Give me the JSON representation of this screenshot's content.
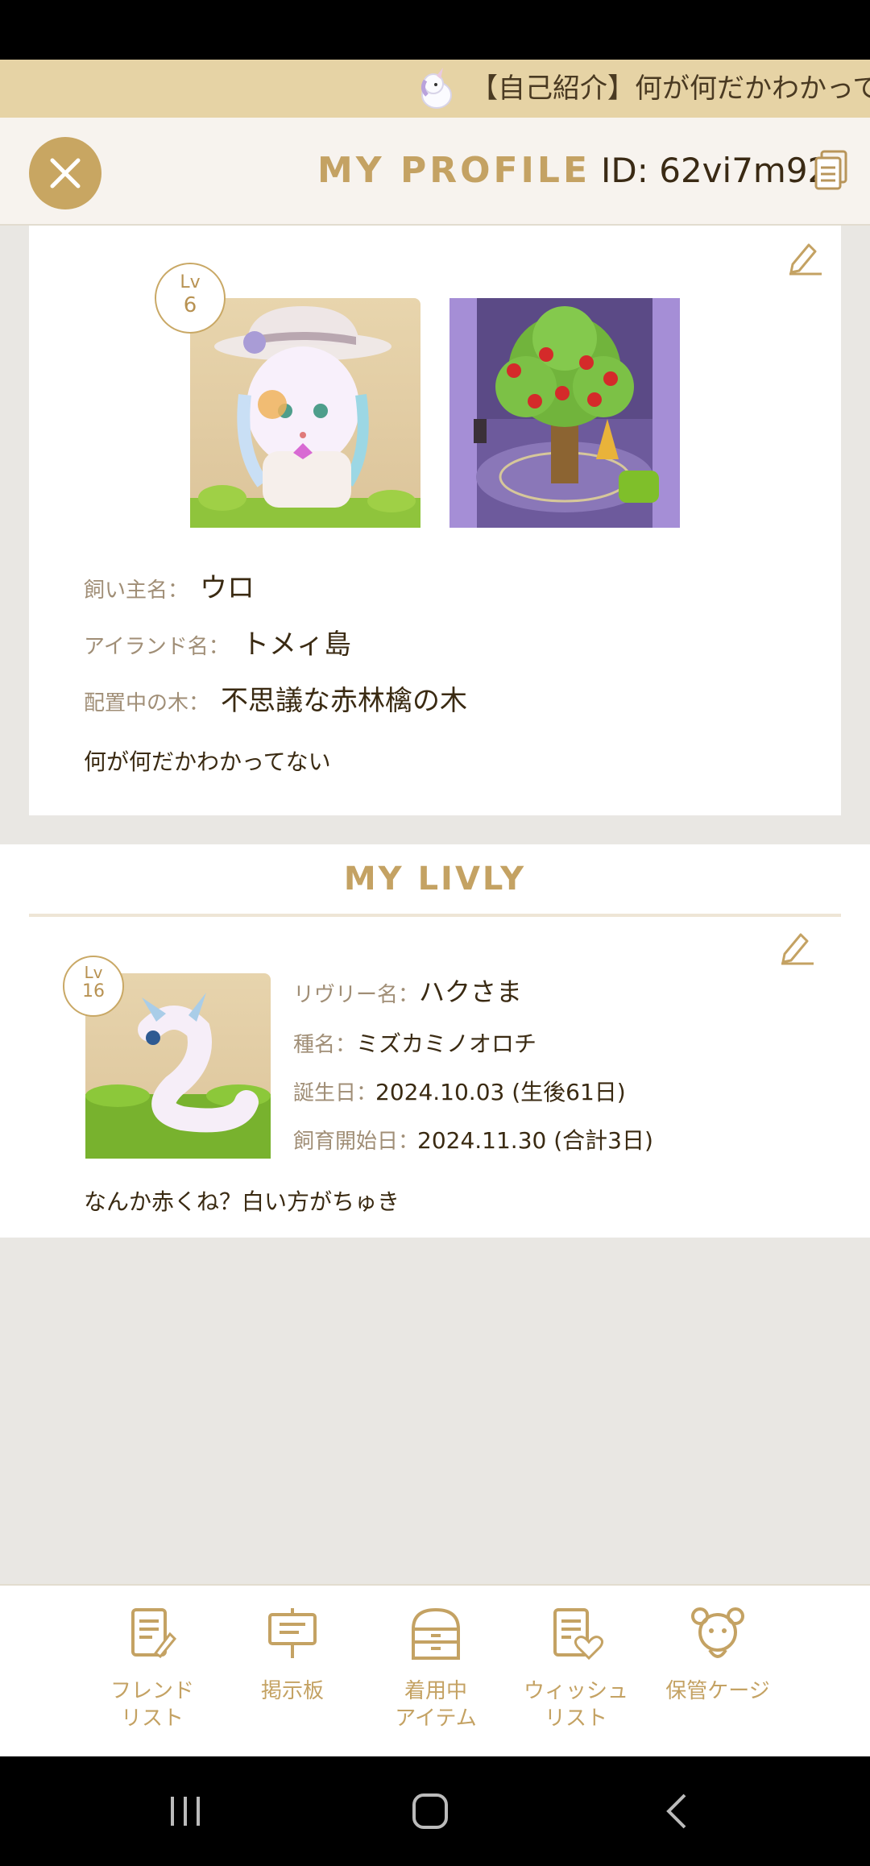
{
  "ticker": {
    "icon": "unicorn-icon",
    "text": "【自己紹介】何が何だかわかって"
  },
  "header": {
    "close_icon": "close-icon",
    "title": "MY PROFILE",
    "id_text": "ID: 62vi7m92",
    "copy_icon": "copy-icon"
  },
  "profile": {
    "level_label": "Lv",
    "level": "6",
    "avatar_image": "owner-avatar-image",
    "island_image": "island-tree-image",
    "fields": [
      {
        "label": "飼い主名：",
        "value": "ウロ"
      },
      {
        "label": "アイランド名：",
        "value": "トメィ島"
      },
      {
        "label": "配置中の木：",
        "value": "不思議な赤林檎の木"
      }
    ],
    "bio": "何が何だかわかってない"
  },
  "livly": {
    "section_title": "MY LIVLY",
    "level_label": "Lv",
    "level": "16",
    "image": "livly-image",
    "fields": [
      {
        "label": "リヴリー名：",
        "value": "ハクさま"
      },
      {
        "label": "種名：",
        "value": "ミズカミノオロチ"
      },
      {
        "label": "誕生日：",
        "value": "2024.10.03 (生後61日)"
      },
      {
        "label": "飼育開始日：",
        "value": "2024.11.30 (合計3日)"
      }
    ],
    "bio": "なんか赤くね？白い方がちゅき"
  },
  "nav": [
    {
      "label": "フレンド\nリスト",
      "icon": "friend-list-icon"
    },
    {
      "label": "掲示板",
      "icon": "bulletin-board-icon"
    },
    {
      "label": "着用中\nアイテム",
      "icon": "wearing-items-icon"
    },
    {
      "label": "ウィッシュ\nリスト",
      "icon": "wishlist-icon"
    },
    {
      "label": "保管ケージ",
      "icon": "storage-cage-icon"
    }
  ],
  "colors": {
    "accent": "#c4a263",
    "ticker_bg": "#e6d3a5",
    "page_bg": "#e9e7e3"
  }
}
